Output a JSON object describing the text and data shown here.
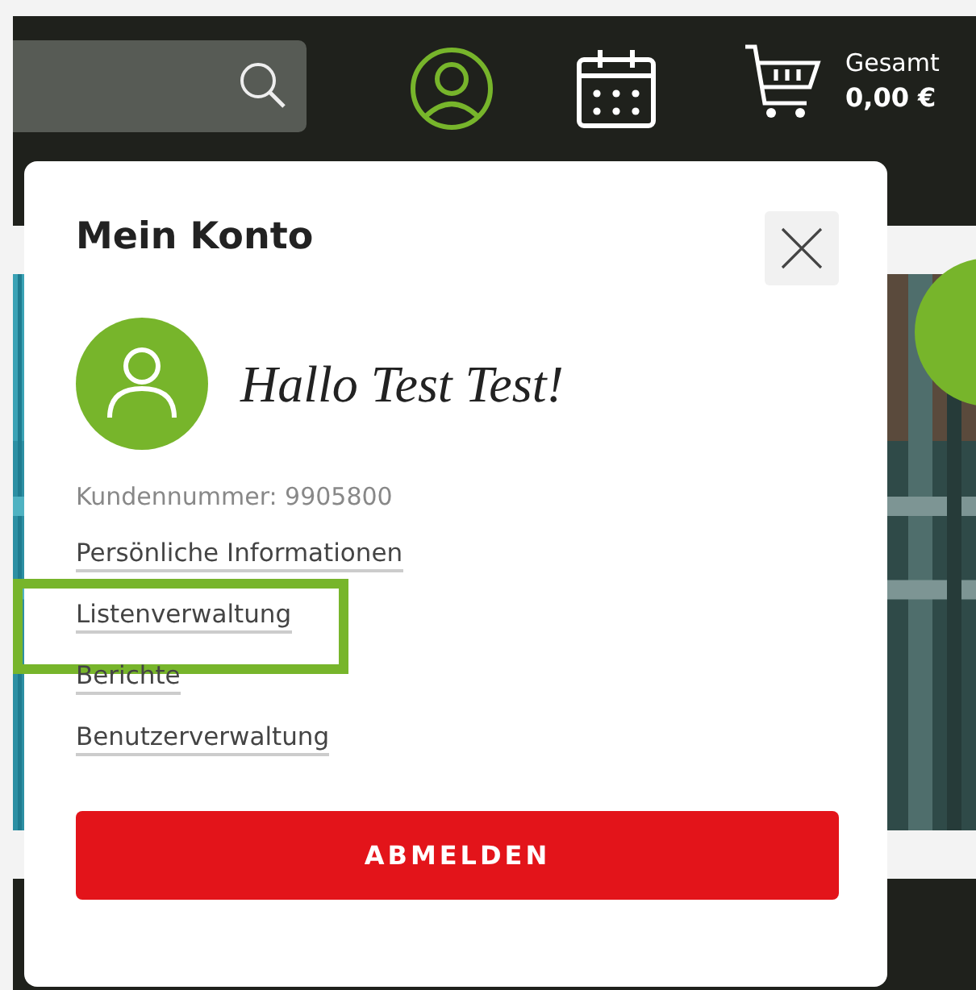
{
  "header": {
    "account_active": true,
    "cart": {
      "label": "Gesamt",
      "total": "0,00 €"
    }
  },
  "account_popup": {
    "title": "Mein Konto",
    "greeting": "Hallo Test Test!",
    "customer_number": "Kundennummer: 9905800",
    "links": [
      {
        "label": "Persönliche Informationen",
        "highlighted": false
      },
      {
        "label": "Listenverwaltung",
        "highlighted": true
      },
      {
        "label": "Berichte",
        "highlighted": false
      },
      {
        "label": "Benutzerverwaltung",
        "highlighted": false
      }
    ],
    "logout_button": "ABMELDEN"
  }
}
